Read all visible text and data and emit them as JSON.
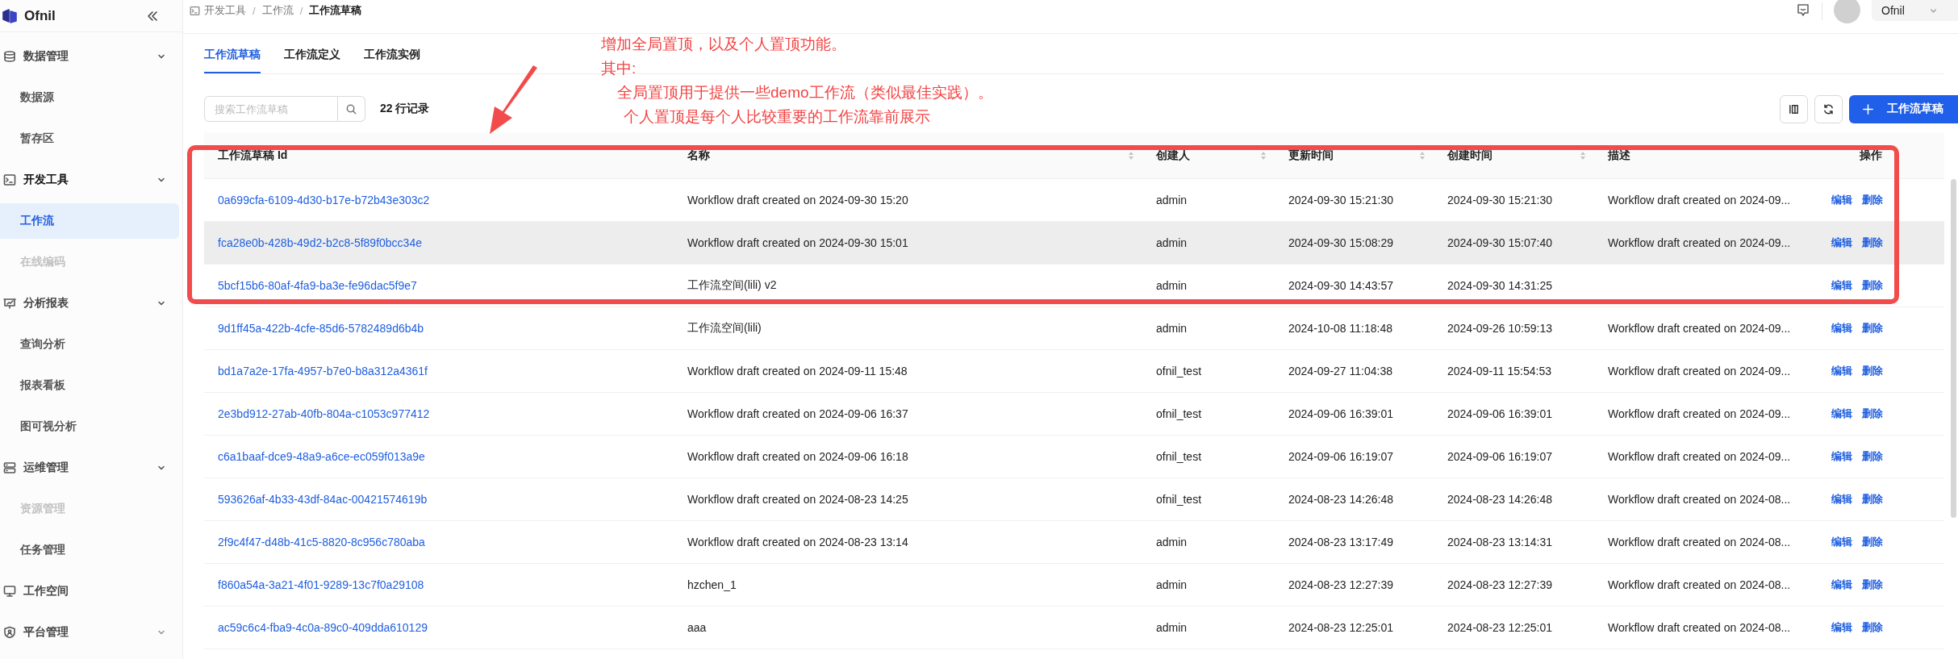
{
  "app": {
    "name": "Ofnil"
  },
  "sidebar": {
    "groups": [
      {
        "label": "数据管理",
        "expanded": true,
        "children": [
          {
            "label": "数据源",
            "selected": false,
            "disabled": false
          },
          {
            "label": "暂存区",
            "selected": false,
            "disabled": false
          }
        ]
      },
      {
        "label": "开发工具",
        "expanded": true,
        "children": [
          {
            "label": "工作流",
            "selected": true,
            "disabled": false
          },
          {
            "label": "在线编码",
            "selected": false,
            "disabled": true
          }
        ]
      },
      {
        "label": "分析报表",
        "expanded": true,
        "children": [
          {
            "label": "查询分析",
            "selected": false,
            "disabled": false
          },
          {
            "label": "报表看板",
            "selected": false,
            "disabled": false
          },
          {
            "label": "图可视分析",
            "selected": false,
            "disabled": false
          }
        ]
      },
      {
        "label": "运维管理",
        "expanded": true,
        "children": [
          {
            "label": "资源管理",
            "selected": false,
            "disabled": true
          },
          {
            "label": "任务管理",
            "selected": false,
            "disabled": false
          }
        ]
      },
      {
        "label": "工作空间"
      },
      {
        "label": "平台管理",
        "expanded": false
      }
    ]
  },
  "breadcrumb": {
    "items": [
      "开发工具",
      "工作流",
      "工作流草稿"
    ],
    "separators": [
      "/",
      "/"
    ]
  },
  "user": {
    "name": "Ofnil"
  },
  "tabs": [
    {
      "label": "工作流草稿",
      "selected": true
    },
    {
      "label": "工作流定义",
      "selected": false
    },
    {
      "label": "工作流实例",
      "selected": false
    }
  ],
  "search": {
    "placeholder": "搜索工作流草稿"
  },
  "record_count": "22 行记录",
  "new_button": {
    "label": "工作流草稿"
  },
  "table": {
    "columns": [
      {
        "label": "工作流草稿 Id",
        "sortable": false
      },
      {
        "label": "名称",
        "sortable": true
      },
      {
        "label": "创建人",
        "sortable": true
      },
      {
        "label": "更新时间",
        "sortable": true
      },
      {
        "label": "创建时间",
        "sortable": true
      },
      {
        "label": "描述",
        "sortable": false
      },
      {
        "label": "操作",
        "sortable": false
      }
    ],
    "row_groups": [
      {
        "framed": true,
        "rows": [
          {
            "id": "0a699cfa-6109-4d30-b17e-b72b43e303c2",
            "name": "Workflow draft created on 2024-09-30 15:20",
            "creator": "admin",
            "updated": "2024-09-30 15:21:30",
            "created": "2024-09-30 15:21:30",
            "description": "Workflow draft created on 2024-09...",
            "actions": [
              "编辑",
              "删除"
            ],
            "hovered": false
          },
          {
            "id": "fca28e0b-428b-49d2-b2c8-5f89f0bcc34e",
            "name": "Workflow draft created on 2024-09-30 15:01",
            "creator": "admin",
            "updated": "2024-09-30 15:08:29",
            "created": "2024-09-30 15:07:40",
            "description": "Workflow draft created on 2024-09...",
            "actions": [
              "编辑",
              "删除"
            ],
            "hovered": true
          },
          {
            "id": "5bcf15b6-80af-4fa9-ba3e-fe96dac5f9e7",
            "name": "工作流空间(lili) v2",
            "creator": "admin",
            "updated": "2024-09-30 14:43:57",
            "created": "2024-09-30 14:31:25",
            "actions": [
              "编辑",
              "删除"
            ],
            "hovered": false
          }
        ]
      },
      {
        "framed": false,
        "rows": [
          {
            "id": "9d1ff45a-422b-4cfe-85d6-5782489d6b4b",
            "name": "工作流空间(lili)",
            "creator": "admin",
            "updated": "2024-10-08 11:18:48",
            "created": "2024-09-26 10:59:13",
            "description": "Workflow draft created on 2024-09...",
            "actions": [
              "编辑",
              "删除"
            ],
            "hovered": false
          },
          {
            "id": "bd1a7a2e-17fa-4957-b7e0-b8a312a4361f",
            "name": "Workflow draft created on 2024-09-11 15:48",
            "creator": "ofnil_test",
            "updated": "2024-09-27 11:04:38",
            "created": "2024-09-11 15:54:53",
            "description": "Workflow draft created on 2024-09...",
            "actions": [
              "编辑",
              "删除"
            ],
            "hovered": false
          },
          {
            "id": "2e3bd912-27ab-40fb-804a-c1053c977412",
            "name": "Workflow draft created on 2024-09-06 16:37",
            "creator": "ofnil_test",
            "updated": "2024-09-06 16:39:01",
            "created": "2024-09-06 16:39:01",
            "description": "Workflow draft created on 2024-09...",
            "actions": [
              "编辑",
              "删除"
            ],
            "hovered": false
          },
          {
            "id": "c6a1baaf-dce9-48a9-a6ce-ec059f013a9e",
            "name": "Workflow draft created on 2024-09-06 16:18",
            "creator": "ofnil_test",
            "updated": "2024-09-06 16:19:07",
            "created": "2024-09-06 16:19:07",
            "description": "Workflow draft created on 2024-09...",
            "actions": [
              "编辑",
              "删除"
            ],
            "hovered": false
          },
          {
            "id": "593626af-4b33-43df-84ac-00421574619b",
            "name": "Workflow draft created on 2024-08-23 14:25",
            "creator": "ofnil_test",
            "updated": "2024-08-23 14:26:48",
            "created": "2024-08-23 14:26:48",
            "description": "Workflow draft created on 2024-08...",
            "actions": [
              "编辑",
              "删除"
            ],
            "hovered": false
          },
          {
            "id": "2f9c4f47-d48b-41c5-8820-8c956c780aba",
            "name": "Workflow draft created on 2024-08-23 13:14",
            "creator": "admin",
            "updated": "2024-08-23 13:17:49",
            "created": "2024-08-23 13:14:31",
            "description": "Workflow draft created on 2024-08...",
            "actions": [
              "编辑",
              "删除"
            ],
            "hovered": false
          },
          {
            "id": "f860a54a-3a21-4f01-9289-13c7f0a29108",
            "name": "hzchen_1",
            "creator": "admin",
            "updated": "2024-08-23 12:27:39",
            "created": "2024-08-23 12:27:39",
            "description": "Workflow draft created on 2024-08...",
            "actions": [
              "编辑",
              "删除"
            ],
            "hovered": false
          },
          {
            "id": "ac59c6c4-fba9-4c0a-89c0-409dda610129",
            "name": "aaa",
            "creator": "admin",
            "updated": "2024-08-23 12:25:01",
            "created": "2024-08-23 12:25:01",
            "description": "Workflow draft created on 2024-08...",
            "actions": [
              "编辑",
              "删除"
            ],
            "hovered": false
          }
        ]
      }
    ]
  },
  "annotation": {
    "lines": [
      "增加全局置顶，以及个人置顶功能。",
      "其中:",
      "全局置顶用于提供一些demo工作流（类似最佳实践）。",
      "个人置顶是每个人比较重要的工作流靠前展示"
    ]
  }
}
